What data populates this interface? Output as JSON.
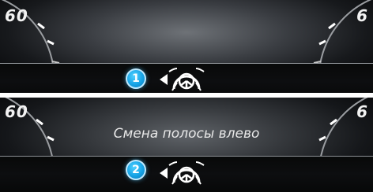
{
  "panels": [
    {
      "gauge_left_value": "60",
      "gauge_right_value": "6",
      "message": "",
      "step_number": "1",
      "indicator_icon": "steering-wheel-lane-change-left-icon"
    },
    {
      "gauge_left_value": "60",
      "gauge_right_value": "6",
      "message": "Смена полосы влево",
      "step_number": "2",
      "indicator_icon": "steering-wheel-lane-change-left-icon"
    }
  ],
  "colors": {
    "badge": "#17a3e6",
    "indicator": "#ffffff",
    "text": "#e8e8e8"
  }
}
